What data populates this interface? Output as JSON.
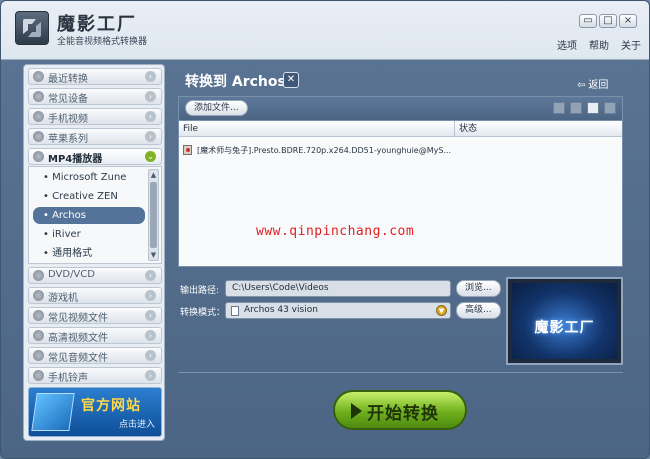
{
  "app": {
    "title": "魔影工厂",
    "subtitle": "全能音视频格式转换器"
  },
  "window_controls": {
    "skin": "▭",
    "maximize": "□",
    "close": "×"
  },
  "top_menu": {
    "options": "选项",
    "help": "帮助",
    "about": "关于"
  },
  "sidebar": {
    "categories_top": [
      {
        "label": "最近转换"
      },
      {
        "label": "常见设备"
      },
      {
        "label": "手机视频"
      },
      {
        "label": "苹果系列"
      },
      {
        "label": "MP4播放器"
      }
    ],
    "sub_items": [
      {
        "label": "Microsoft Zune"
      },
      {
        "label": "Creative ZEN"
      },
      {
        "label": "Archos"
      },
      {
        "label": "iRiver"
      },
      {
        "label": "通用格式"
      }
    ],
    "categories_bottom": [
      {
        "label": "DVD/VCD"
      },
      {
        "label": "游戏机"
      },
      {
        "label": "常见视频文件"
      },
      {
        "label": "高清视频文件"
      },
      {
        "label": "常见音频文件"
      },
      {
        "label": "手机铃声"
      }
    ],
    "banner": {
      "title": "官方网站",
      "sub": "点击进入"
    }
  },
  "main": {
    "title": "转换到 Archos",
    "back_label": "返回",
    "add_file_label": "添加文件...",
    "table": {
      "col_file": "File",
      "col_status": "状态",
      "rows": [
        {
          "file": "[魔术师与兔子].Presto.BDRE.720p.x264.DD51-younghuie@MyS..."
        }
      ]
    },
    "watermark": "www.qinpinchang.com",
    "output_path_label": "输出路径:",
    "output_path_value": "C:\\Users\\Code\\Videos",
    "browse_label": "浏览...",
    "mode_label": "转换模式：",
    "mode_value": "Archos 43 vision",
    "advanced_label": "高级...",
    "preview_text": "魔影工厂",
    "start_label": "开始转换"
  },
  "colors": {
    "accent_green": "#6fb01d",
    "panel_blue": "#4c6585",
    "watermark_red": "#e01e1e"
  }
}
